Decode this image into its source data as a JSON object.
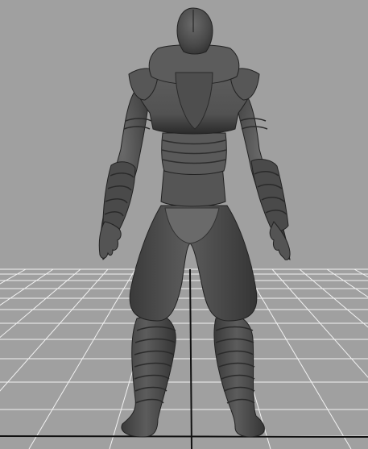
{
  "viewport": {
    "background_color": "#a0a0a0",
    "grid_color": "#f2f2f2",
    "axis_color": "#111111",
    "view": "back",
    "grid": true
  },
  "model": {
    "type": "character-mesh",
    "shading": "smooth-shaded",
    "color": "#505050"
  }
}
